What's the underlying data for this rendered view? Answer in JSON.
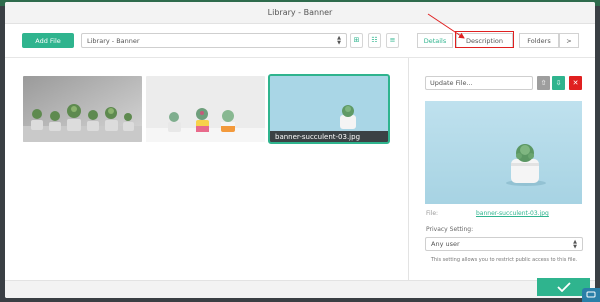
{
  "modal": {
    "title": "Library - Banner"
  },
  "toolbar": {
    "add_file_label": "Add File",
    "library_select_value": "Library - Banner",
    "view_modes": [
      "grid-small-icon",
      "list-icon",
      "list-detail-icon"
    ]
  },
  "tabs": [
    {
      "label": "Details",
      "active": true
    },
    {
      "label": "Description",
      "active": false
    },
    {
      "label": "Folders",
      "active": false
    },
    {
      "label": ">",
      "active": false
    }
  ],
  "gallery": {
    "items": [
      {
        "caption": "",
        "selected": false
      },
      {
        "caption": "",
        "selected": false
      },
      {
        "caption": "banner-succulent-03.jpg",
        "selected": true
      }
    ]
  },
  "details": {
    "update_placeholder": "Update File...",
    "file_label": "File:",
    "file_name": "banner-succulent-03.jpg",
    "privacy_label": "Privacy Setting:",
    "privacy_value": "Any user",
    "privacy_help": "This setting allows you to restrict public access to this file."
  },
  "colors": {
    "accent": "#2fb48e",
    "danger": "#e02020",
    "annotation": "#e02020",
    "header_bg": "#f3f3f3"
  }
}
